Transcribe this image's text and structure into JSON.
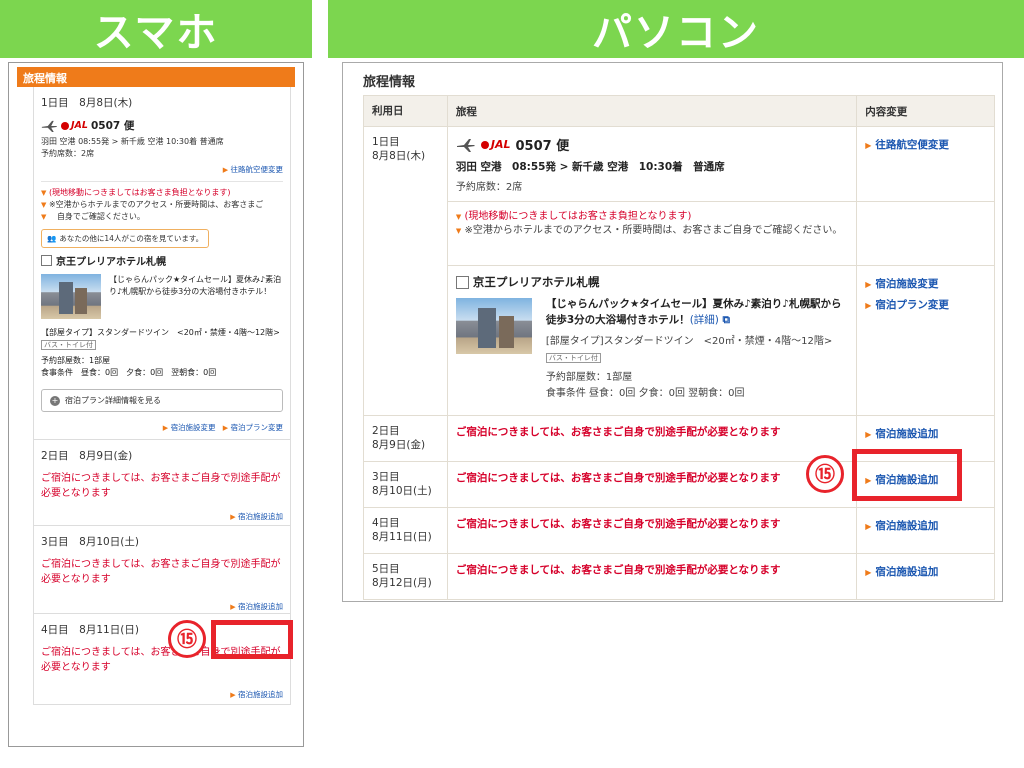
{
  "banners": {
    "smartphone": "スマホ",
    "pc": "パソコン"
  },
  "marker": "⑮",
  "smartphone": {
    "header": "旅程情報",
    "day1": {
      "date": "1日目　8月8日(木)",
      "airline": "JAL",
      "flight": "0507 便",
      "route": "羽田 空港 08:55発 > 新千歳 空港 10:30着 普通席",
      "seats": "予約席数：2席",
      "flight_change_link": "往路航空便変更",
      "note1": "(現地移動につきましてはお客さま負担となります)",
      "note2": "※空港からホテルまでのアクセス・所要時間は、お客さまご",
      "note3": "自身でご確認ください。",
      "viewing": "あなたの他に14人がこの宿を見ています。",
      "hotel_name": "京王プレリアホテル札幌",
      "plan_title": "【じゃらんパック★タイムセール】夏休み♪素泊り♪札幌駅から徒歩3分の大浴場付きホテル！",
      "room_type": "【部屋タイプ】スタンダードツイン　<20㎡・禁煙・4階〜12階>",
      "bath_tag": "バス・トイレ付",
      "rooms": "予約部屋数：1部屋",
      "meals": "食事条件　昼食：0回　夕食：0回　翌朝食：0回",
      "detail_button": "宿泊プラン詳細情報を見る",
      "hotel_change_link": "宿泊施設変更",
      "plan_change_link": "宿泊プラン変更"
    },
    "days": [
      {
        "date": "2日目　8月9日(金)",
        "message": "ご宿泊につきましては、お客さまご自身で別途手配が必要となります",
        "link": "宿泊施設追加"
      },
      {
        "date": "3日目　8月10日(土)",
        "message": "ご宿泊につきましては、お客さまご自身で別途手配が必要となります",
        "link": "宿泊施設追加"
      },
      {
        "date": "4日目　8月11日(日)",
        "message": "ご宿泊につきましては、お客さまご自身で別途手配が必要となります",
        "link": "宿泊施設追加"
      }
    ]
  },
  "pc": {
    "title": "旅程情報",
    "columns": [
      "利用日",
      "旅程",
      "内容変更"
    ],
    "day1": {
      "date_line1": "1日目",
      "date_line2": "8月8日(木)",
      "airline": "JAL",
      "flight": "0507 便",
      "route": "羽田 空港　08:55発 > 新千歳 空港　10:30着　普通席",
      "seats": "予約席数：2席",
      "flight_change_link": "往路航空便変更",
      "note1": "(現地移動につきましてはお客さま負担となります)",
      "note2": "※空港からホテルまでのアクセス・所要時間は、お客さまご自身でご確認ください。",
      "hotel_name": "京王プレリアホテル札幌",
      "plan_title": "【じゃらんパック★タイムセール】夏休み♪素泊り♪札幌駅から徒歩3分の大浴場付きホテル！",
      "detail_link": "(詳細)",
      "room_type": "[部屋タイプ]スタンダードツイン　<20㎡・禁煙・4階〜12階>",
      "bath_tag": "バス・トイレ付",
      "rooms": "予約部屋数：1部屋",
      "meals": "食事条件 昼食：0回 夕食：0回 翌朝食：0回",
      "hotel_change_link": "宿泊施設変更",
      "plan_change_link": "宿泊プラン変更"
    },
    "days": [
      {
        "date_line1": "2日目",
        "date_line2": "8月9日(金)",
        "message": "ご宿泊につきましては、お客さまご自身で別途手配が必要となります",
        "link": "宿泊施設追加"
      },
      {
        "date_line1": "3日目",
        "date_line2": "8月10日(土)",
        "message": "ご宿泊につきましては、お客さまご自身で別途手配が必要となります",
        "link": "宿泊施設追加"
      },
      {
        "date_line1": "4日目",
        "date_line2": "8月11日(日)",
        "message": "ご宿泊につきましては、お客さまご自身で別途手配が必要となります",
        "link": "宿泊施設追加"
      },
      {
        "date_line1": "5日目",
        "date_line2": "8月12日(月)",
        "message": "ご宿泊につきましては、お客さまご自身で別途手配が必要となります",
        "link": "宿泊施設追加"
      }
    ]
  },
  "colors": {
    "banner_green": "#7cd64f",
    "orange": "#ef7b1a",
    "red_text": "#d6002a",
    "link_blue": "#1a56b0",
    "highlight_red": "#e8232b"
  }
}
